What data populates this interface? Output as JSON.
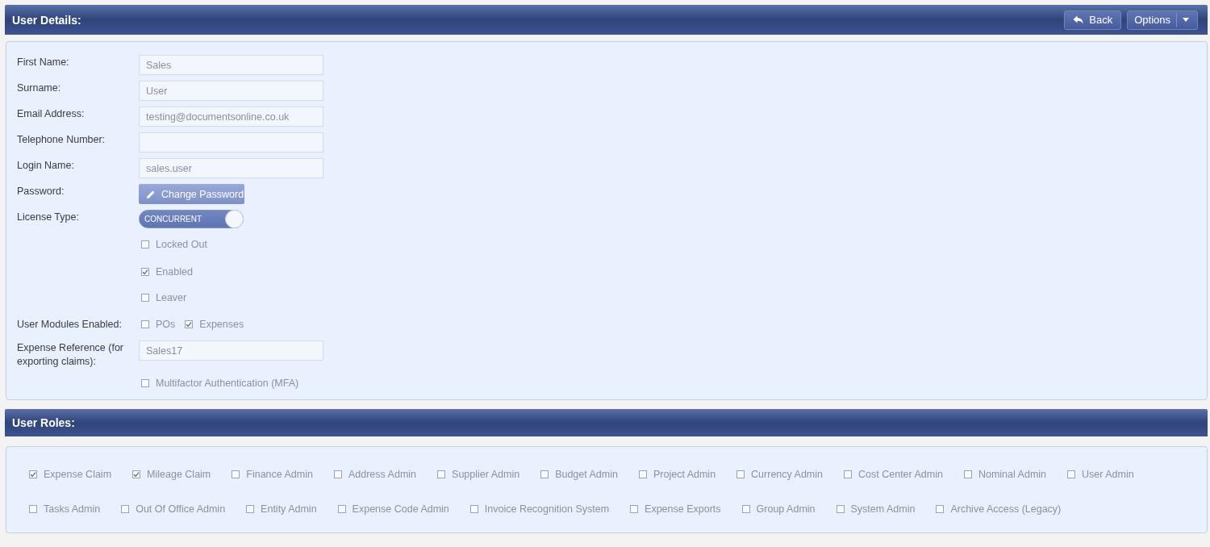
{
  "user_details": {
    "title": "User Details:",
    "header_buttons": [
      {
        "kind": "back",
        "label": "Back"
      },
      {
        "kind": "dropdown",
        "label": "Options"
      }
    ],
    "rows": [
      {
        "kind": "text",
        "label": "First Name:",
        "value": "Sales"
      },
      {
        "kind": "text",
        "label": "Surname:",
        "value": "User"
      },
      {
        "kind": "text",
        "label": "Email Address:",
        "value": "testing@documentsonline.co.uk"
      },
      {
        "kind": "text",
        "label": "Telephone Number:"
      },
      {
        "kind": "text",
        "label": "Login Name:",
        "value": "sales.user"
      },
      {
        "kind": "button",
        "label": "Password:",
        "button": "Change Password"
      },
      {
        "kind": "toggle",
        "label": "License Type:",
        "value": "CONCURRENT",
        "on": true
      },
      {
        "kind": "checkbox",
        "text": "Locked Out",
        "checked": false
      },
      {
        "kind": "checkbox",
        "text": "Enabled",
        "checked": true
      },
      {
        "kind": "checkbox",
        "text": "Leaver",
        "checked": false
      },
      {
        "kind": "checkboxes",
        "label": "User Modules Enabled:",
        "options": [
          {
            "text": "POs",
            "checked": false
          },
          {
            "text": "Expenses",
            "checked": true
          }
        ]
      },
      {
        "kind": "text",
        "label": "Expense Reference (for exporting claims):",
        "value": "Sales17"
      },
      {
        "kind": "checkbox",
        "text": "Multifactor Authentication (MFA)",
        "checked": false
      }
    ]
  },
  "user_roles": {
    "title": "User Roles:",
    "roles": [
      {
        "text": "Expense Claim",
        "checked": true
      },
      {
        "text": "Mileage Claim",
        "checked": true
      },
      {
        "text": "Finance Admin",
        "checked": false
      },
      {
        "text": "Address Admin",
        "checked": false
      },
      {
        "text": "Supplier Admin",
        "checked": false
      },
      {
        "text": "Budget Admin",
        "checked": false
      },
      {
        "text": "Project Admin",
        "checked": false
      },
      {
        "text": "Currency Admin",
        "checked": false
      },
      {
        "text": "Cost Center Admin",
        "checked": false
      },
      {
        "text": "Nominal Admin",
        "checked": false
      },
      {
        "text": "User Admin",
        "checked": false
      },
      {
        "text": "Tasks Admin",
        "checked": false
      },
      {
        "text": "Out Of Office Admin",
        "checked": false
      },
      {
        "text": "Entity Admin",
        "checked": false
      },
      {
        "text": "Expense Code Admin",
        "checked": false
      },
      {
        "text": "Invoice Recognition System",
        "checked": false
      },
      {
        "text": "Expense Exports",
        "checked": false
      },
      {
        "text": "Group Admin",
        "checked": false
      },
      {
        "text": "System Admin",
        "checked": false
      },
      {
        "text": "Archive Access (Legacy)",
        "checked": false
      }
    ]
  }
}
